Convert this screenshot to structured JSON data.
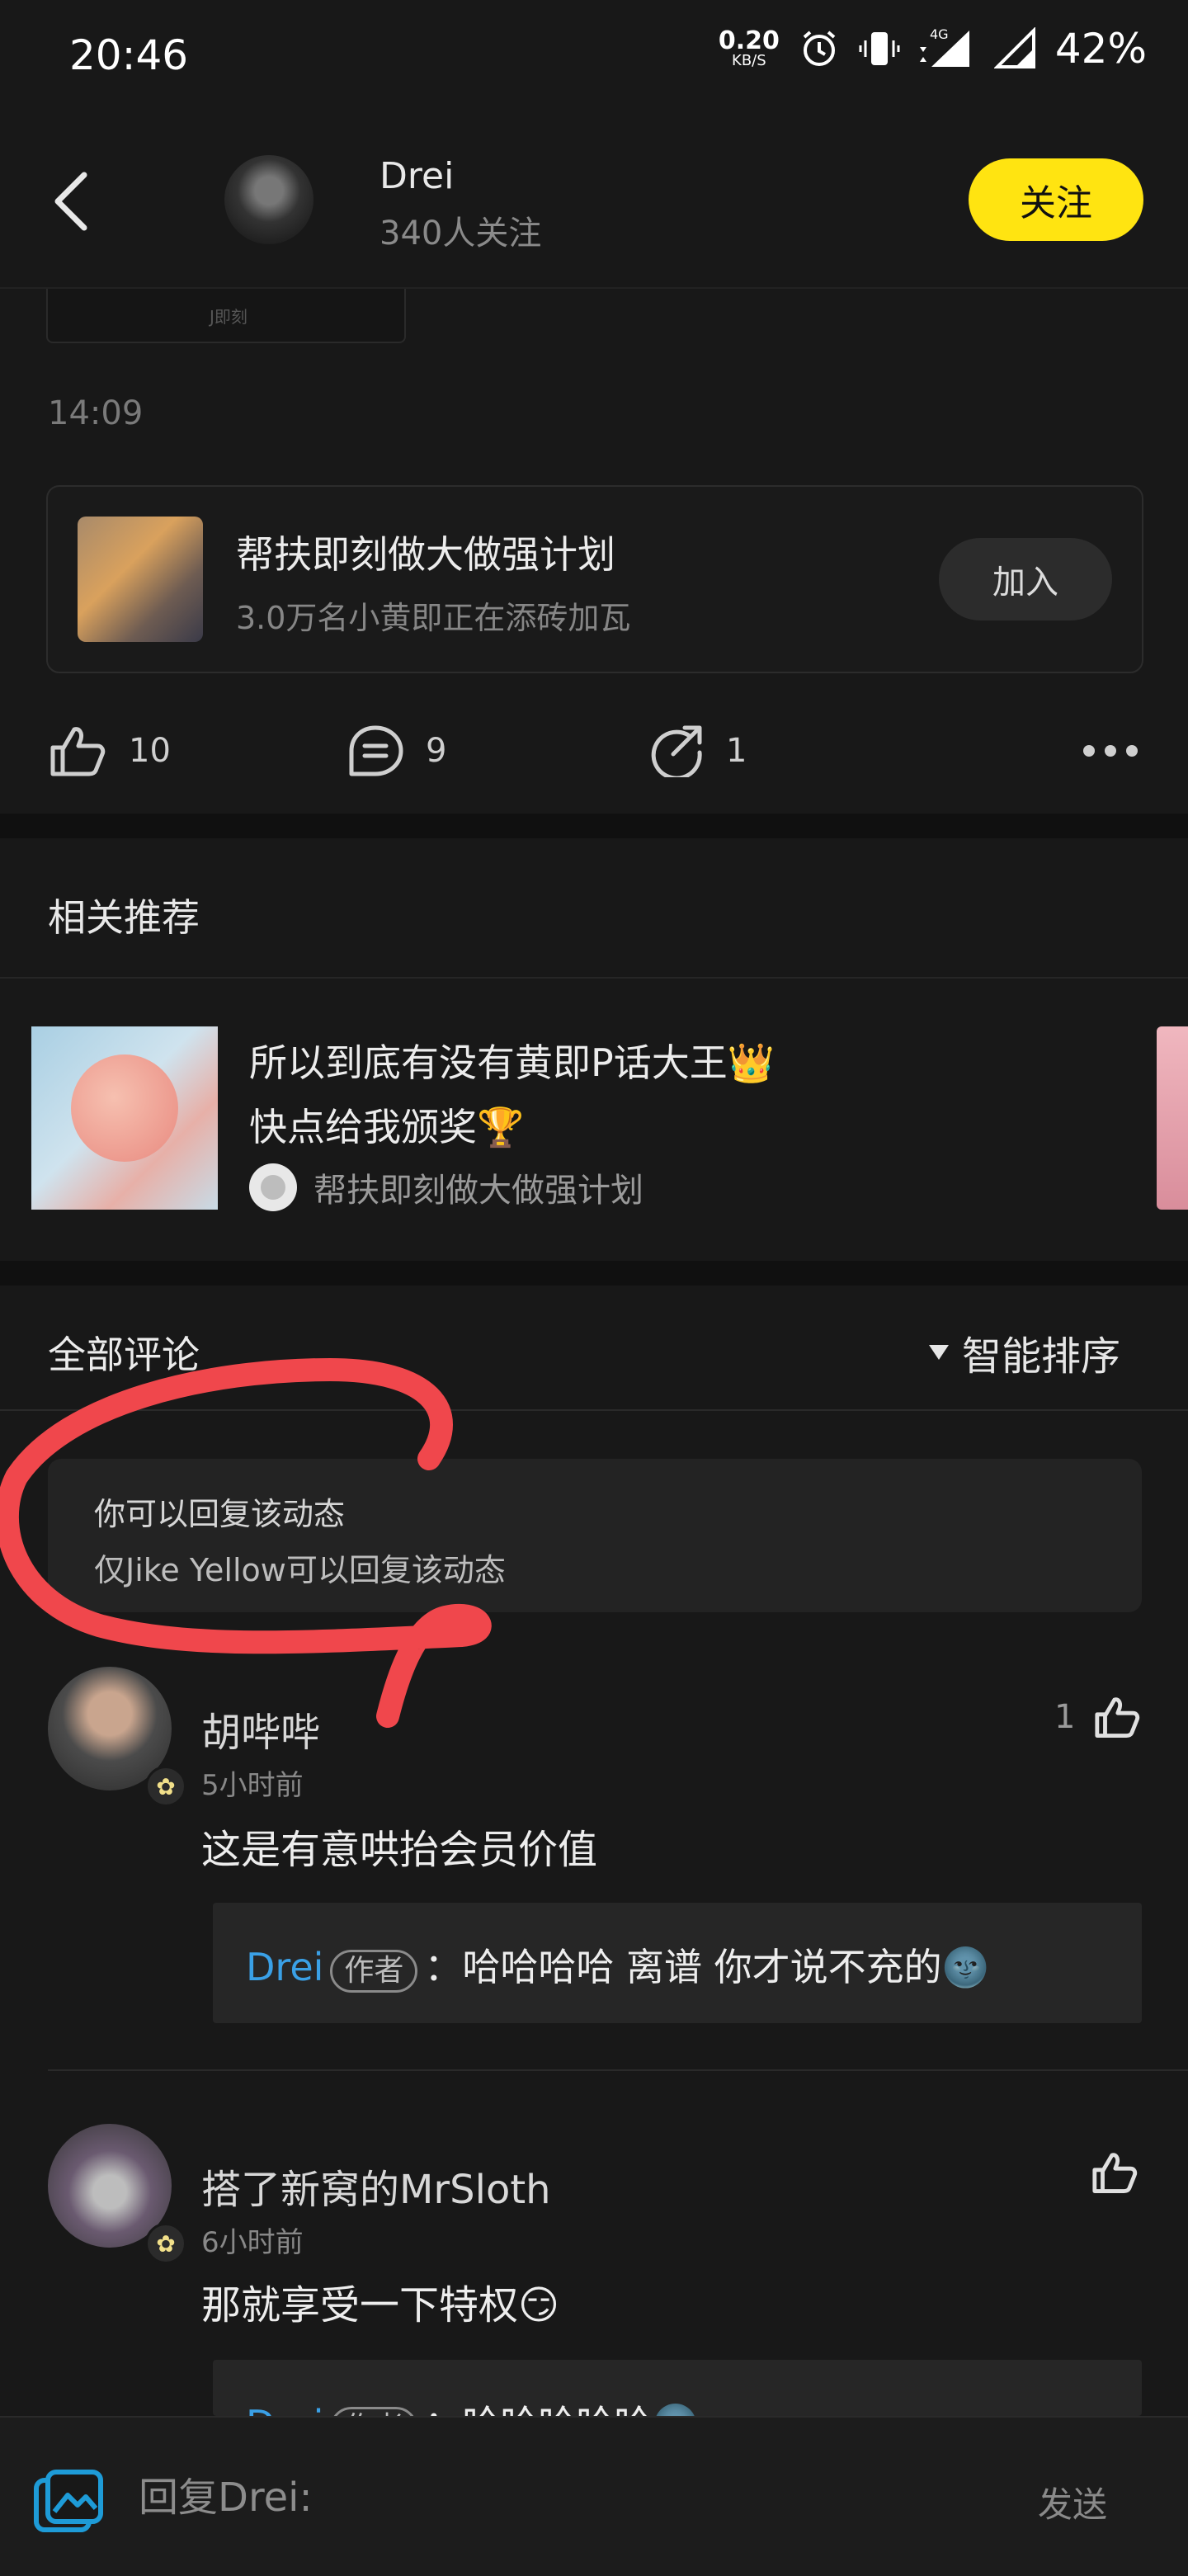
{
  "status_bar": {
    "time": "20:46",
    "net_speed_value": "0.20",
    "net_speed_unit": "KB/S",
    "network_type": "4G",
    "battery": "42%"
  },
  "header": {
    "user_name": "Drei",
    "follower_count": "340人关注",
    "follow_label": "关注"
  },
  "post": {
    "image_watermark": "J即刻",
    "time": "14:09",
    "topic": {
      "title": "帮扶即刻做大做强计划",
      "subtitle": "3.0万名小黄即正在添砖加瓦",
      "join_label": "加入"
    },
    "actions": {
      "likes": "10",
      "comments": "9",
      "shares": "1"
    }
  },
  "related": {
    "title": "相关推荐",
    "item": {
      "line1": "所以到底有没有黄即P话大王👑",
      "line2": "快点给我颁奖🏆",
      "topic": "帮扶即刻做大做强计划"
    }
  },
  "comments_section": {
    "title": "全部评论",
    "sort_label": "智能排序",
    "reply_notice": {
      "line1": "你可以回复该动态",
      "line2": "仅Jike Yellow可以回复该动态"
    },
    "comments": [
      {
        "name": "胡哔哔",
        "time": "5小时前",
        "likes": "1",
        "text": "这是有意哄抬会员价值",
        "reply": {
          "author": "Drei",
          "tag": "作者",
          "text": "：哈哈哈哈 离谱 你才说不充的🌚"
        }
      },
      {
        "name": "搭了新窝的MrSloth",
        "time": "6小时前",
        "likes": "",
        "text": "那就享受一下特权😏",
        "reply": {
          "author": "Drei",
          "tag": "作者",
          "text": "：哈哈哈哈哈🌚"
        }
      }
    ]
  },
  "bottom_bar": {
    "reply_placeholder": "回复Drei:",
    "send_label": "发送"
  },
  "colors": {
    "background": "#181818",
    "accent_yellow": "#FFE411",
    "link_blue": "#3AA0E6",
    "annotation_red": "#F0474C"
  }
}
